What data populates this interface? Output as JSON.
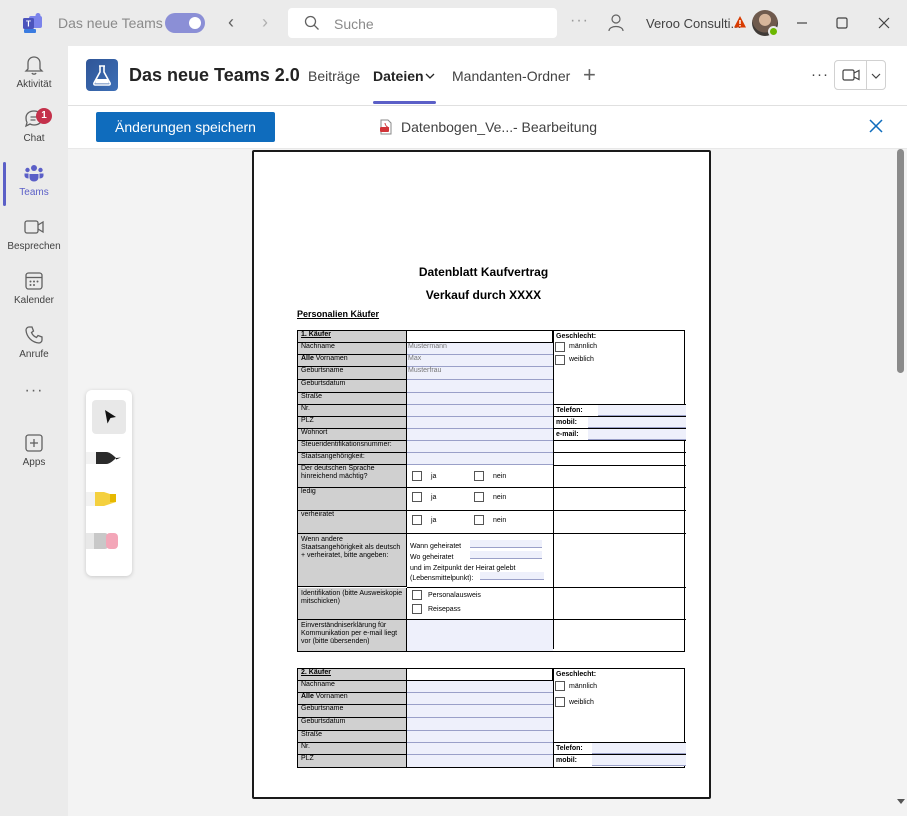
{
  "titlebar": {
    "app_name": "Das neue Teams",
    "search_placeholder": "Suche",
    "more": "···",
    "org_name": "Veroo Consulti...",
    "colors": {
      "toggle": "#8b8fd6",
      "warning": "#d83b01"
    }
  },
  "rail": {
    "items": [
      {
        "label": "Aktivität",
        "icon": "bell-icon"
      },
      {
        "label": "Chat",
        "icon": "chat-icon",
        "badge": "1"
      },
      {
        "label": "Teams",
        "icon": "teams-icon",
        "active": true
      },
      {
        "label": "Besprechen",
        "icon": "video-icon"
      },
      {
        "label": "Kalender",
        "icon": "calendar-icon"
      },
      {
        "label": "Anrufe",
        "icon": "phone-icon"
      },
      {
        "label": "Apps",
        "icon": "apps-add-icon"
      }
    ],
    "more": "···",
    "accent": "#5b5fc7"
  },
  "header": {
    "team_name": "Das neue Teams 2.0",
    "tabs": [
      {
        "label": "Beiträge"
      },
      {
        "label": "Dateien",
        "active": true
      },
      {
        "label": "Mandanten-Ordner"
      }
    ],
    "add_tab": "+",
    "more": "···"
  },
  "editor": {
    "save_label": "Änderungen speichern",
    "file_name": "Datenbogen_Ve...",
    "mode": "- Bearbeitung",
    "save_color": "#0f6cbd"
  },
  "ink_tools": [
    "select-arrow-icon",
    "pen-icon",
    "highlighter-icon",
    "eraser-icon"
  ],
  "document": {
    "title": "Datenblatt Kaufvertrag",
    "subtitle": "Verkauf durch XXXX",
    "section": "Personalien Käufer",
    "buyer1": {
      "heading": "1. Käufer",
      "rows": [
        {
          "label": "Nachname",
          "value": "Mustermann"
        },
        {
          "label_bold": "Alle",
          "label": " Vornamen",
          "value": "Max"
        },
        {
          "label": "Geburtsname",
          "value": "Musterfrau"
        },
        {
          "label": "Geburtsdatum",
          "value": ""
        },
        {
          "label": "Straße",
          "value": ""
        },
        {
          "label": "Nr.",
          "value": ""
        },
        {
          "label": "PLZ",
          "value": ""
        },
        {
          "label": "Wohnort",
          "value": ""
        },
        {
          "label": "Steueridentifikationsnummer:",
          "value": ""
        },
        {
          "label": "Staatsangehörigkeit:",
          "value": ""
        }
      ],
      "gender_heading": "Geschlecht:",
      "gender_options": [
        "männlich",
        "weiblich"
      ],
      "contact": [
        "Telefon:",
        "mobil:",
        "e-mail:"
      ],
      "language_label": "Der deutschen Sprache hinreichend mächtig?",
      "single_label": "ledig",
      "married_label": "verheiratet",
      "yes": "ja",
      "no": "nein",
      "other_nat_label": "Wenn andere Staatsangehörigkeit als deutsch + verheiratet, bitte angeben:",
      "other_nat_lines": [
        "Wann geheiratet",
        "Wo geheiratet",
        "und im Zeitpunkt der Heirat gelebt",
        "(Lebensmittelpunkt):"
      ],
      "id_label": "Identifikation (bitte Ausweiskopie mitschicken)",
      "id_options": [
        "Personalausweis",
        "Reisepass"
      ],
      "consent_label": "Einverständniserklärung für Kommunikation per e-mail liegt vor (bitte übersenden)"
    },
    "buyer2": {
      "heading": "2. Käufer",
      "rows": [
        {
          "label": "Nachname"
        },
        {
          "label_bold": "Alle",
          "label": " Vornamen"
        },
        {
          "label": "Geburtsname"
        },
        {
          "label": "Geburtsdatum"
        },
        {
          "label": "Straße"
        },
        {
          "label": "Nr."
        },
        {
          "label": "PLZ"
        }
      ],
      "gender_heading": "Geschlecht:",
      "gender_options": [
        "männlich",
        "weiblich"
      ],
      "contact": [
        "Telefon:",
        "mobil:"
      ]
    }
  }
}
